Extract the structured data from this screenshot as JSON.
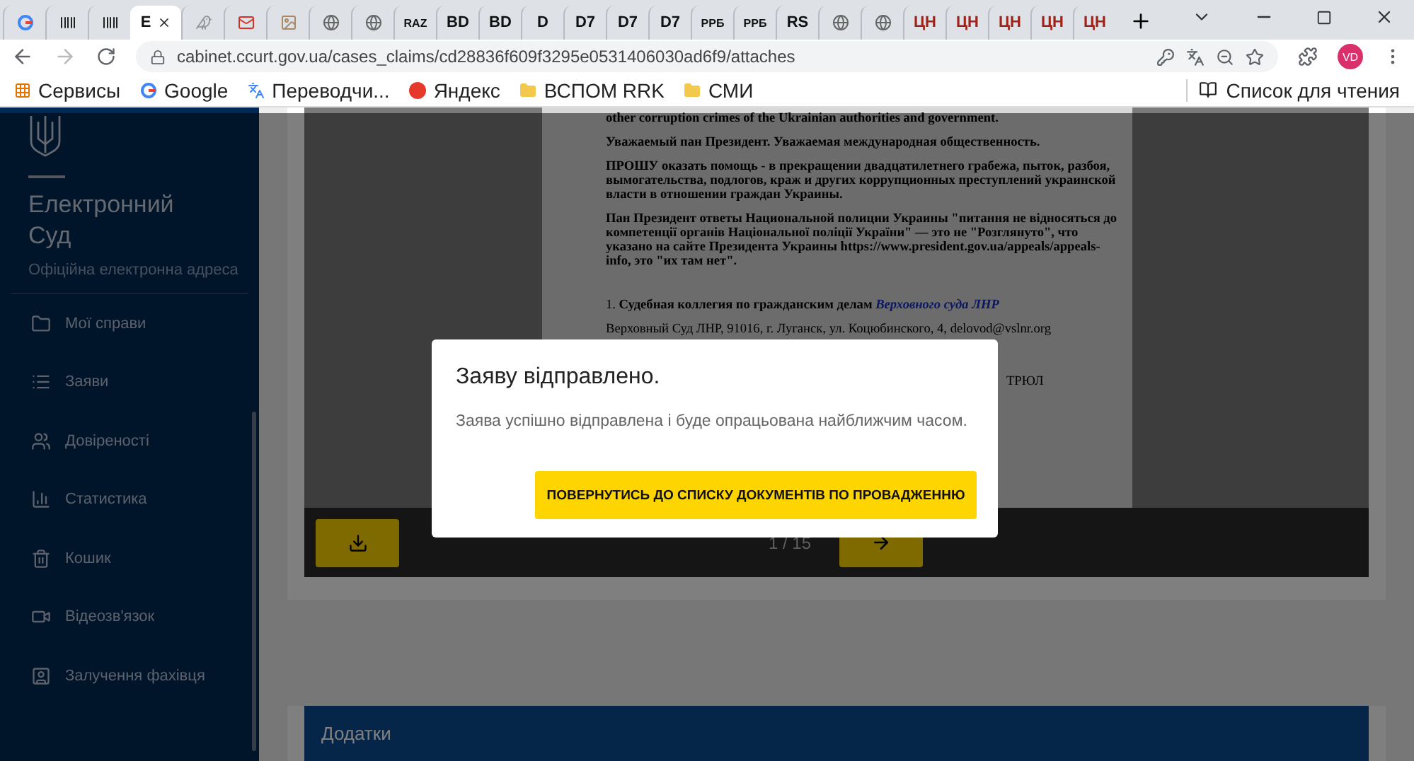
{
  "browser": {
    "tabs": [
      {
        "kind": "google",
        "selected": false
      },
      {
        "kind": "barcode",
        "selected": false
      },
      {
        "kind": "barcode",
        "selected": false
      },
      {
        "kind": "text",
        "label": "Е",
        "selected": true
      },
      {
        "kind": "bird",
        "selected": false
      },
      {
        "kind": "mail",
        "selected": false
      },
      {
        "kind": "image",
        "selected": false
      },
      {
        "kind": "globe",
        "selected": false
      },
      {
        "kind": "globe",
        "selected": false
      },
      {
        "kind": "text",
        "label": "RAZ",
        "selected": false
      },
      {
        "kind": "text",
        "label": "BD",
        "selected": false
      },
      {
        "kind": "text",
        "label": "BD",
        "selected": false
      },
      {
        "kind": "text",
        "label": "D",
        "selected": false
      },
      {
        "kind": "text",
        "label": "D7",
        "selected": false
      },
      {
        "kind": "text",
        "label": "D7",
        "selected": false
      },
      {
        "kind": "text",
        "label": "D7",
        "selected": false
      },
      {
        "kind": "text",
        "label": "РРБ",
        "selected": false
      },
      {
        "kind": "text",
        "label": "РРБ",
        "selected": false
      },
      {
        "kind": "text",
        "label": "RS",
        "selected": false
      },
      {
        "kind": "globe",
        "selected": false
      },
      {
        "kind": "globe",
        "selected": false
      },
      {
        "kind": "text",
        "label": "ЦН",
        "selected": false
      },
      {
        "kind": "text",
        "label": "ЦН",
        "selected": false
      },
      {
        "kind": "text",
        "label": "ЦН",
        "selected": false
      },
      {
        "kind": "text",
        "label": "ЦН",
        "selected": false
      },
      {
        "kind": "text",
        "label": "ЦН",
        "selected": false
      }
    ],
    "url": "cabinet.ccurt.gov.ua/cases_claims/cd28836f609f3295e0531406030ad6f9/attaches",
    "profile": "VD",
    "bookmarks": [
      {
        "kind": "apps",
        "label": "Сервисы"
      },
      {
        "kind": "google",
        "label": "Google"
      },
      {
        "kind": "translate",
        "label": "Переводчи..."
      },
      {
        "kind": "yandex",
        "label": "Яндекс"
      },
      {
        "kind": "folder",
        "label": "ВСПОМ RRK"
      },
      {
        "kind": "folder",
        "label": "СМИ"
      }
    ],
    "reading_list": "Список для чтения"
  },
  "sidebar": {
    "title": "Електронний Суд",
    "subtitle": "Офіційна електронна адреса",
    "items": [
      {
        "kind": "folder",
        "label": "Мої справи"
      },
      {
        "kind": "list",
        "label": "Заяви"
      },
      {
        "kind": "people",
        "label": "Довіреності"
      },
      {
        "kind": "chart",
        "label": "Статистика"
      },
      {
        "kind": "trash",
        "label": "Кошик"
      },
      {
        "kind": "video",
        "label": "Відеозв'язок"
      },
      {
        "kind": "expert",
        "label": "Залучення фахівця"
      }
    ]
  },
  "document": {
    "paragraphs": [
      {
        "kind": "bold",
        "text": "other corruption crimes of the Ukrainian authorities and government."
      },
      {
        "kind": "bold",
        "text": "Уважаемый пан Президент. Уважаемая международная общественность."
      },
      {
        "kind": "bold",
        "text": "ПРОШУ оказать помощь - в прекращении двадцатилетнего грабежа, пыток, разбоя, вымогательства, подлогов, краж и других коррупционных преступлений украинской власти в отношении граждан Украины."
      },
      {
        "kind": "bold",
        "text": "Пан Президент ответы Национальной полиции Украины \"питання не відносяться до компетенції органів Національної поліції України\" — это не \"Розглянуто\", что указано на сайте Президента Украины https://www.president.gov.ua/appeals/appeals-info, это \"их там нет\"."
      },
      {
        "kind": "heading",
        "text": "1. **Судебная коллегия по гражданским делам** *Верховного суда ЛНР*"
      },
      {
        "kind": "normal",
        "text": "Верховный Суд ЛНР, 91016, г. Луганск, ул. Коцюбинского, 4, delovod@vslnr.org"
      },
      {
        "kind": "aside",
        "text": "ТРЮЛ"
      }
    ],
    "page": "1 / 15"
  },
  "attachments": {
    "title": "Додатки"
  },
  "dialog": {
    "title": "Заяву відправлено.",
    "message": "Заява успішно відправлена і буде опрацьована найближчим часом.",
    "button": "ПОВЕРНУТИСЬ ДО СПИСКУ ДОКУМЕНТІВ ПО ПРОВАДЖЕННЮ"
  }
}
